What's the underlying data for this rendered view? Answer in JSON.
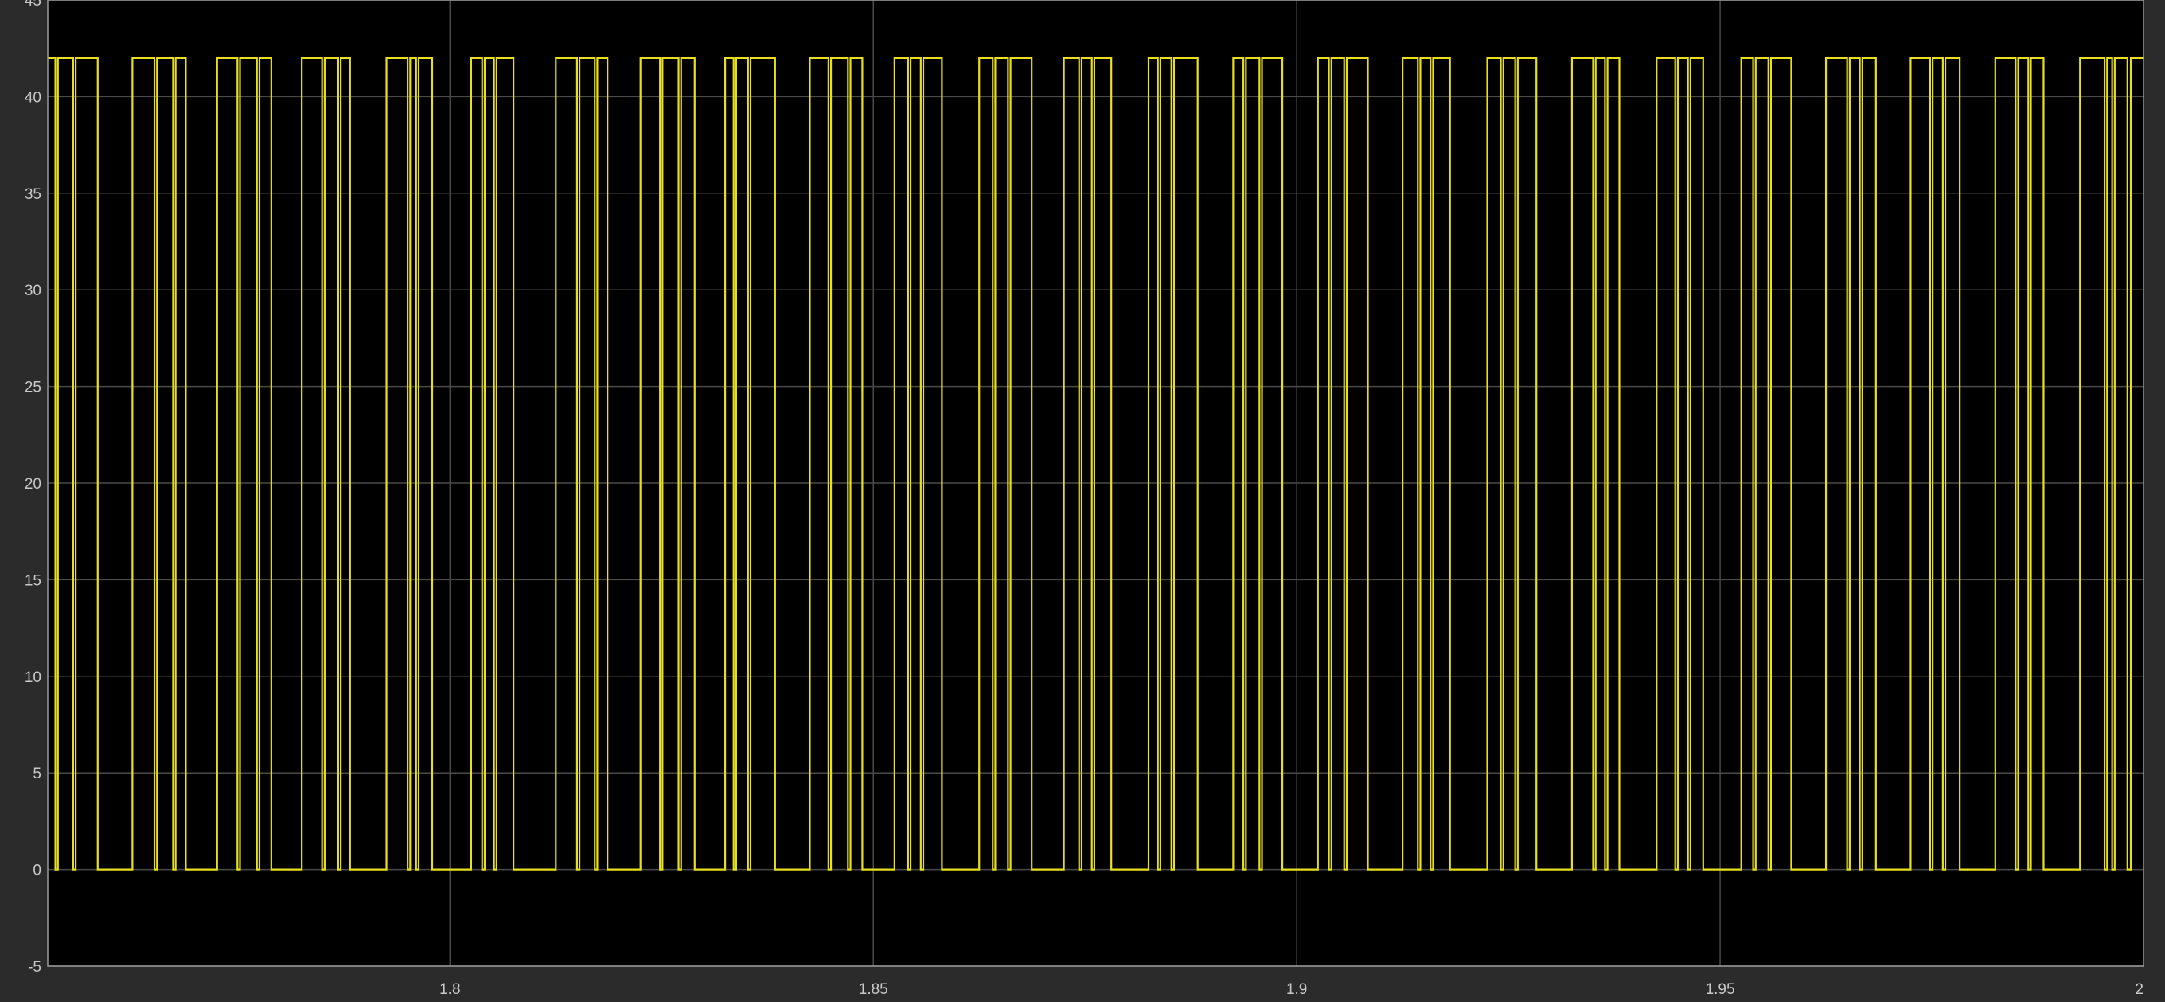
{
  "chart_data": {
    "type": "line",
    "title": "",
    "xlabel": "",
    "ylabel": "",
    "xlim": [
      1.7525,
      2.0
    ],
    "ylim": [
      -5,
      45
    ],
    "grid": true,
    "x_ticks": [
      {
        "value": 1.8,
        "label": "1.8"
      },
      {
        "value": 1.85,
        "label": "1.85"
      },
      {
        "value": 1.9,
        "label": "1.9"
      },
      {
        "value": 1.95,
        "label": "1.95"
      },
      {
        "value": 2.0,
        "label": "2"
      }
    ],
    "y_ticks": [
      {
        "value": 45,
        "label": "45"
      },
      {
        "value": 40,
        "label": "40"
      },
      {
        "value": 35,
        "label": "35"
      },
      {
        "value": 30,
        "label": "30"
      },
      {
        "value": 25,
        "label": "25"
      },
      {
        "value": 20,
        "label": "20"
      },
      {
        "value": 15,
        "label": "15"
      },
      {
        "value": 10,
        "label": "10"
      },
      {
        "value": 5,
        "label": "5"
      },
      {
        "value": 0,
        "label": "0"
      },
      {
        "value": -5,
        "label": "-5"
      }
    ],
    "colors": {
      "figure_bg": "#2b2b2b",
      "plot_bg": "#000000",
      "grid": "#4a4a4a",
      "axis": "#9a9a9a",
      "series": "#e8e01c"
    },
    "series": [
      {
        "high": 42,
        "low": 0,
        "high_intervals": [
          [
            1.7525,
            1.7534
          ],
          [
            1.7537,
            1.7555
          ],
          [
            1.7558,
            1.7584
          ],
          [
            1.7625,
            1.7651
          ],
          [
            1.7654,
            1.7673
          ],
          [
            1.7676,
            1.7688
          ],
          [
            1.7725,
            1.7749
          ],
          [
            1.7752,
            1.7772
          ],
          [
            1.7775,
            1.7789
          ],
          [
            1.7825,
            1.7849
          ],
          [
            1.7852,
            1.7868
          ],
          [
            1.7871,
            1.7882
          ],
          [
            1.7925,
            1.795
          ],
          [
            1.7953,
            1.796
          ],
          [
            1.7963,
            1.7979
          ],
          [
            1.8025,
            1.8038
          ],
          [
            1.8041,
            1.8052
          ],
          [
            1.8055,
            1.8075
          ],
          [
            1.8125,
            1.815
          ],
          [
            1.8153,
            1.8171
          ],
          [
            1.8174,
            1.8186
          ],
          [
            1.8225,
            1.8248
          ],
          [
            1.8251,
            1.827
          ],
          [
            1.8273,
            1.8289
          ],
          [
            1.8325,
            1.8335
          ],
          [
            1.8338,
            1.8352
          ],
          [
            1.8355,
            1.8384
          ],
          [
            1.8425,
            1.8447
          ],
          [
            1.845,
            1.847
          ],
          [
            1.8473,
            1.8487
          ],
          [
            1.8525,
            1.8541
          ],
          [
            1.8544,
            1.8556
          ],
          [
            1.8559,
            1.8581
          ],
          [
            1.8625,
            1.8641
          ],
          [
            1.8644,
            1.8659
          ],
          [
            1.8662,
            1.8687
          ],
          [
            1.8725,
            1.8743
          ],
          [
            1.8746,
            1.8758
          ],
          [
            1.8761,
            1.8781
          ],
          [
            1.8825,
            1.8836
          ],
          [
            1.8839,
            1.8852
          ],
          [
            1.8855,
            1.8883
          ],
          [
            1.8925,
            1.8937
          ],
          [
            1.894,
            1.8956
          ],
          [
            1.8959,
            1.8983
          ],
          [
            1.9025,
            1.9038
          ],
          [
            1.9041,
            1.9056
          ],
          [
            1.9059,
            1.9084
          ],
          [
            1.9125,
            1.9143
          ],
          [
            1.9146,
            1.9158
          ],
          [
            1.9161,
            1.9181
          ],
          [
            1.9225,
            1.9241
          ],
          [
            1.9244,
            1.9258
          ],
          [
            1.9261,
            1.9283
          ],
          [
            1.9325,
            1.935
          ],
          [
            1.9353,
            1.9364
          ],
          [
            1.9367,
            1.9381
          ],
          [
            1.9425,
            1.9447
          ],
          [
            1.945,
            1.9462
          ],
          [
            1.9465,
            1.948
          ],
          [
            1.9525,
            1.9539
          ],
          [
            1.9542,
            1.9557
          ],
          [
            1.956,
            1.9584
          ],
          [
            1.9625,
            1.965
          ],
          [
            1.9653,
            1.9665
          ],
          [
            1.9668,
            1.9684
          ],
          [
            1.9725,
            1.9748
          ],
          [
            1.9751,
            1.9763
          ],
          [
            1.9766,
            1.9783
          ],
          [
            1.9825,
            1.9849
          ],
          [
            1.9852,
            1.9864
          ],
          [
            1.9867,
            1.9882
          ],
          [
            1.9925,
            1.9954
          ],
          [
            1.9957,
            1.9963
          ],
          [
            1.9966,
            1.9981
          ],
          [
            1.9985,
            2.0
          ]
        ]
      }
    ]
  }
}
